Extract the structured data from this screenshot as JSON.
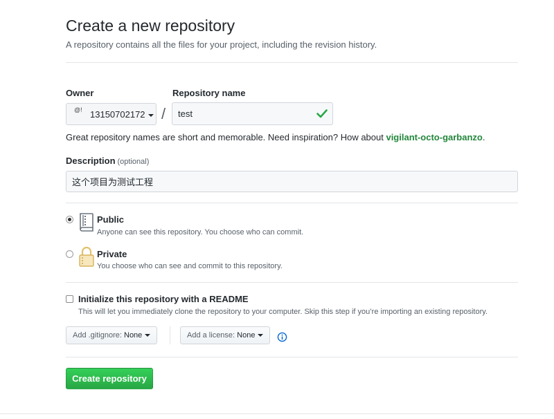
{
  "header": {
    "title": "Create a new repository",
    "subtitle": "A repository contains all the files for your project, including the revision history."
  },
  "owner": {
    "label": "Owner",
    "avatar_text": "@!",
    "value": "13150702172"
  },
  "separator": "/",
  "repository": {
    "label": "Repository name",
    "value": "test",
    "valid_icon": "check-icon"
  },
  "name_hint": {
    "text": "Great repository names are short and memorable. Need inspiration? How about ",
    "suggestion": "vigilant-octo-garbanzo",
    "suffix": "."
  },
  "description": {
    "label": "Description",
    "optional": "(optional)",
    "value": "这个项目为测试工程"
  },
  "visibility": {
    "selected": "public",
    "public": {
      "title": "Public",
      "desc": "Anyone can see this repository. You choose who can commit.",
      "icon": "repo-icon"
    },
    "private": {
      "title": "Private",
      "desc": "You choose who can see and commit to this repository.",
      "icon": "lock-icon"
    }
  },
  "readme": {
    "checked": false,
    "title": "Initialize this repository with a README",
    "desc": "This will let you immediately clone the repository to your computer. Skip this step if you’re importing an existing repository."
  },
  "gitignore": {
    "label": "Add .gitignore:",
    "value": "None"
  },
  "license": {
    "label": "Add a license:",
    "value": "None"
  },
  "create_button": "Create repository",
  "colors": {
    "accent_green": "#28a745",
    "link_green": "#22863a",
    "text": "#24292e",
    "muted": "#586069",
    "border": "#e1e4e8",
    "info_blue": "#0366d6"
  }
}
